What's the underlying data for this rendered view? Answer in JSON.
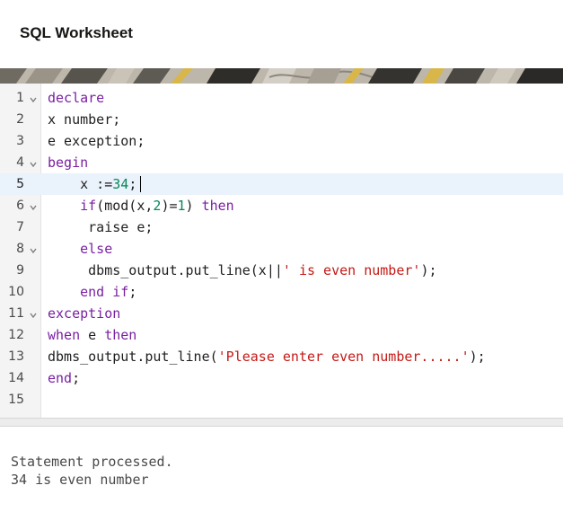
{
  "header": {
    "title": "SQL Worksheet"
  },
  "editor": {
    "active_line": 5,
    "lines": [
      {
        "number": "1",
        "foldable": true,
        "tokens": [
          {
            "t": "declare",
            "c": "kw"
          }
        ]
      },
      {
        "number": "2",
        "foldable": false,
        "tokens": [
          {
            "t": "x number;",
            "c": ""
          }
        ]
      },
      {
        "number": "3",
        "foldable": false,
        "tokens": [
          {
            "t": "e exception;",
            "c": ""
          }
        ]
      },
      {
        "number": "4",
        "foldable": true,
        "tokens": [
          {
            "t": "begin",
            "c": "kw"
          }
        ]
      },
      {
        "number": "5",
        "foldable": false,
        "tokens": [
          {
            "t": "    x :=",
            "c": ""
          },
          {
            "t": "34",
            "c": "num"
          },
          {
            "t": ";",
            "c": ""
          }
        ]
      },
      {
        "number": "6",
        "foldable": true,
        "tokens": [
          {
            "t": "    ",
            "c": ""
          },
          {
            "t": "if",
            "c": "kw"
          },
          {
            "t": "(mod(x,",
            "c": ""
          },
          {
            "t": "2",
            "c": "num"
          },
          {
            "t": ")=",
            "c": ""
          },
          {
            "t": "1",
            "c": "num"
          },
          {
            "t": ") ",
            "c": ""
          },
          {
            "t": "then",
            "c": "kw"
          }
        ]
      },
      {
        "number": "7",
        "foldable": false,
        "tokens": [
          {
            "t": "     raise e;",
            "c": ""
          }
        ]
      },
      {
        "number": "8",
        "foldable": true,
        "tokens": [
          {
            "t": "    ",
            "c": ""
          },
          {
            "t": "else",
            "c": "kw"
          }
        ]
      },
      {
        "number": "9",
        "foldable": false,
        "tokens": [
          {
            "t": "     dbms_output.put_line(x||",
            "c": ""
          },
          {
            "t": "' is even number'",
            "c": "str"
          },
          {
            "t": ");",
            "c": ""
          }
        ]
      },
      {
        "number": "10",
        "foldable": false,
        "tokens": [
          {
            "t": "    ",
            "c": ""
          },
          {
            "t": "end if",
            "c": "kw"
          },
          {
            "t": ";",
            "c": ""
          }
        ]
      },
      {
        "number": "11",
        "foldable": true,
        "tokens": [
          {
            "t": "exception",
            "c": "kw"
          }
        ]
      },
      {
        "number": "12",
        "foldable": false,
        "tokens": [
          {
            "t": "when",
            "c": "kw"
          },
          {
            "t": " e ",
            "c": ""
          },
          {
            "t": "then",
            "c": "kw"
          }
        ]
      },
      {
        "number": "13",
        "foldable": false,
        "tokens": [
          {
            "t": "dbms_output.put_line(",
            "c": ""
          },
          {
            "t": "'Please enter even number.....'",
            "c": "str"
          },
          {
            "t": ");",
            "c": ""
          }
        ]
      },
      {
        "number": "14",
        "foldable": false,
        "tokens": [
          {
            "t": "end",
            "c": "kw"
          },
          {
            "t": ";",
            "c": ""
          }
        ]
      },
      {
        "number": "15",
        "foldable": false,
        "tokens": []
      }
    ]
  },
  "output": {
    "lines": [
      "Statement processed.",
      "34 is even number"
    ]
  },
  "colors": {
    "keyword": "#7a1fa2",
    "number": "#098658",
    "string": "#c41a16",
    "active_line_bg": "#eaf2fb"
  },
  "icons": {
    "fold": "chevron-down-icon"
  }
}
